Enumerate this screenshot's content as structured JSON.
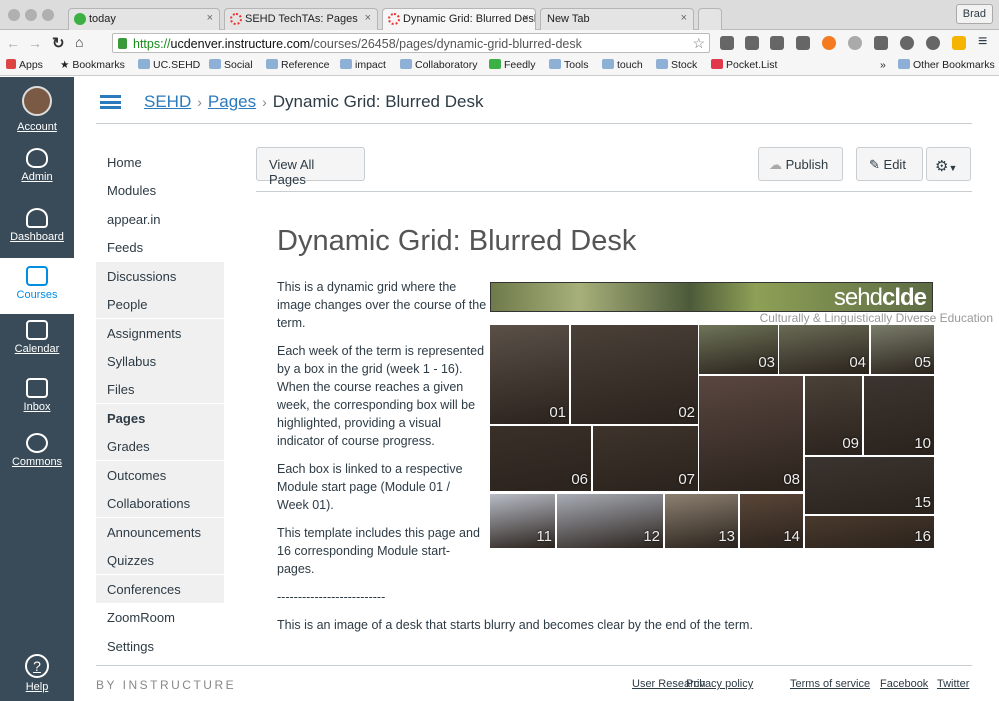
{
  "browser": {
    "tabs": [
      {
        "label": "today"
      },
      {
        "label": "SEHD TechTAs: Pages"
      },
      {
        "label": "Dynamic Grid: Blurred Desk"
      },
      {
        "label": "New Tab"
      }
    ],
    "user": "Brad",
    "url_scheme": "https://",
    "url_host": "ucdenver.instructure.com",
    "url_path": "/courses/26458/pages/dynamic-grid-blurred-desk",
    "bookmarks": [
      "Apps",
      "Bookmarks",
      "UC.SEHD",
      "Social",
      "Reference",
      "impact",
      "Collaboratory",
      "Feedly",
      "Tools",
      "touch",
      "Stock",
      "Pocket.List",
      "»",
      "Other Bookmarks"
    ]
  },
  "global_nav": [
    {
      "label": "Account"
    },
    {
      "label": "Admin"
    },
    {
      "label": "Dashboard"
    },
    {
      "label": "Courses"
    },
    {
      "label": "Calendar"
    },
    {
      "label": "Inbox"
    },
    {
      "label": "Commons"
    },
    {
      "label": "Help"
    }
  ],
  "breadcrumb": {
    "course": "SEHD",
    "section": "Pages",
    "current": "Dynamic Grid: Blurred Desk"
  },
  "course_nav": [
    "Home",
    "Modules",
    "appear.in",
    "Feeds",
    "Discussions",
    "People",
    "Assignments",
    "Syllabus",
    "Files",
    "Pages",
    "Grades",
    "Outcomes",
    "Collaborations",
    "Announcements",
    "Quizzes",
    "Conferences",
    "ZoomRoom",
    "Settings"
  ],
  "toolbar": {
    "view_all": "View All Pages",
    "publish": "Publish",
    "edit": "Edit"
  },
  "page": {
    "title": "Dynamic Grid: Blurred Desk",
    "paragraphs": [
      "This is a dynamic grid where the image changes over the course of the term.",
      "Each week of the term is represented by a box in the grid (week 1 - 16). When the course reaches a given week, the corresponding box will be highlighted, providing a visual indicator of course progress.",
      "Each box is linked to a respective Module start page (Module 01 / Week 01).",
      "This template includes this page and 16 corresponding Module start-pages."
    ],
    "divider": "--------------------------",
    "caption": "This is an image of a desk that starts blurry and becomes clear by the end of the term.",
    "banner_logo_light": "sehd",
    "banner_logo_bold": "clde",
    "banner_tagline": "Culturally & Linguistically Diverse Education",
    "grid": [
      "01",
      "02",
      "03",
      "04",
      "05",
      "06",
      "07",
      "08",
      "09",
      "10",
      "11",
      "12",
      "13",
      "14",
      "15",
      "16"
    ]
  },
  "footer": {
    "brand": "BY INSTRUCTURE",
    "links": [
      "User Research",
      "Privacy policy",
      "Terms of service",
      "Facebook",
      "Twitter"
    ]
  }
}
